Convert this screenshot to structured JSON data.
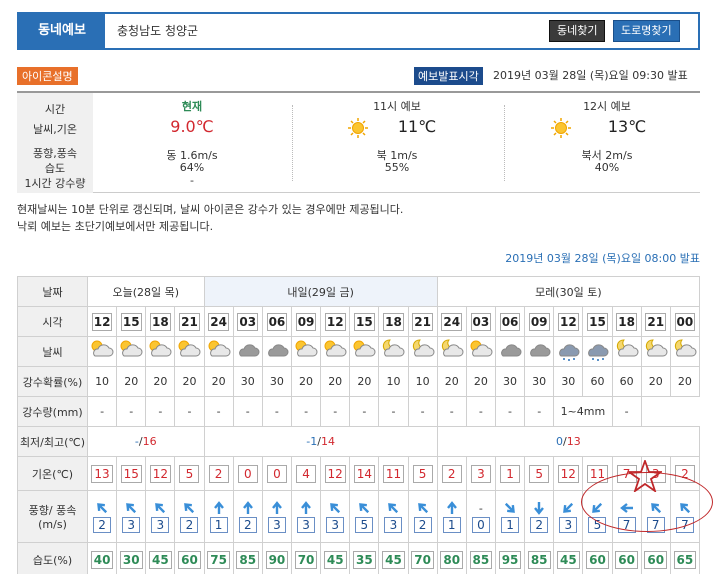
{
  "header": {
    "tab_label": "동네예보",
    "location": "충청남도 청양군",
    "find_area": "동네찾기",
    "find_road": "도로명찾기"
  },
  "info": {
    "icon_guide": "아이콘설명",
    "issue_label": "예보발표시각",
    "issue_time": "2019년 03월 28일 (목)요일 09:30 발표"
  },
  "current": {
    "labels": [
      "시간",
      "날씨,기온",
      "풍향,풍속",
      "습도",
      "1시간 강수량"
    ],
    "now": {
      "title": "현재",
      "temp": "9.0℃",
      "wind": "동 1.6m/s",
      "humidity": "64%",
      "rain": "-"
    },
    "f11": {
      "title": "11시 예보",
      "temp": "11℃",
      "wind": "북 1m/s",
      "humidity": "55%"
    },
    "f12": {
      "title": "12시 예보",
      "temp": "13℃",
      "wind": "북서 2m/s",
      "humidity": "40%"
    }
  },
  "notes": [
    "현재날씨는 10분 단위로 갱신되며, 날씨 아이콘은 강수가 있는 경우에만 제공됩니다.",
    "낙뢰 예보는 초단기예보에서만 제공됩니다."
  ],
  "forecast_issue": "2019년 03월 28일 (목)요일 08:00 발표",
  "rows": {
    "date": "날짜",
    "time": "시각",
    "weather": "날씨",
    "pop": "강수확률(%)",
    "rain": "강수량(mm)",
    "minmax": "최저/최고(℃)",
    "temp": "기온(℃)",
    "wind": "풍향/ 풍속(m/s)",
    "humidity": "습도(%)"
  },
  "days": {
    "today": "오늘(28일 목)",
    "tomorrow": "내일(29일 금)",
    "dayafter": "모레(30일 토)"
  },
  "hours": [
    "12",
    "15",
    "18",
    "21",
    "24",
    "03",
    "06",
    "09",
    "12",
    "15",
    "18",
    "21",
    "24",
    "03",
    "06",
    "09",
    "12",
    "15",
    "18",
    "21",
    "00"
  ],
  "pop": [
    "10",
    "20",
    "20",
    "20",
    "20",
    "30",
    "30",
    "20",
    "20",
    "20",
    "10",
    "10",
    "20",
    "20",
    "30",
    "30",
    "30",
    "60",
    "60",
    "20",
    "20"
  ],
  "rain": [
    "-",
    "-",
    "-",
    "-",
    "-",
    "-",
    "-",
    "-",
    "-",
    "-",
    "-",
    "-",
    "-",
    "-",
    "-",
    "-",
    "1~4mm",
    "-"
  ],
  "minmax": {
    "today_min": "-",
    "today_max": "16",
    "tom_min": "-1",
    "tom_max": "14",
    "da_min": "0",
    "da_max": "13"
  },
  "temps": [
    "13",
    "15",
    "12",
    "5",
    "2",
    "0",
    "0",
    "4",
    "12",
    "14",
    "11",
    "5",
    "2",
    "3",
    "1",
    "5",
    "12",
    "11",
    "7",
    "3",
    "2"
  ],
  "wind_speed": [
    "2",
    "3",
    "3",
    "2",
    "1",
    "2",
    "3",
    "3",
    "3",
    "5",
    "3",
    "2",
    "1",
    "0",
    "1",
    "2",
    "3",
    "5",
    "7",
    "7",
    "7"
  ],
  "humidity": [
    "40",
    "30",
    "45",
    "60",
    "75",
    "85",
    "90",
    "70",
    "45",
    "35",
    "45",
    "70",
    "80",
    "85",
    "95",
    "85",
    "45",
    "60",
    "60",
    "60",
    "65"
  ],
  "weather_icons": [
    "partly-cloudy",
    "partly-cloudy",
    "partly-cloudy",
    "partly-cloudy",
    "partly-cloudy",
    "cloudy",
    "cloudy",
    "partly-cloudy",
    "partly-cloudy",
    "partly-cloudy",
    "moon-cloudy",
    "moon-cloudy",
    "moon-cloudy",
    "partly-cloudy",
    "cloudy",
    "cloudy",
    "rain-snow",
    "rain-snow",
    "moon-cloudy",
    "moon-cloudy",
    "moon-cloudy"
  ],
  "wind_dirs": [
    135,
    135,
    135,
    135,
    180,
    180,
    180,
    180,
    135,
    135,
    135,
    135,
    180,
    "none",
    315,
    0,
    45,
    45,
    90,
    135,
    135
  ],
  "colors": {
    "accent": "#2a6fb5",
    "temp_red": "#d2282f",
    "humidity_green": "#2e8b57"
  }
}
